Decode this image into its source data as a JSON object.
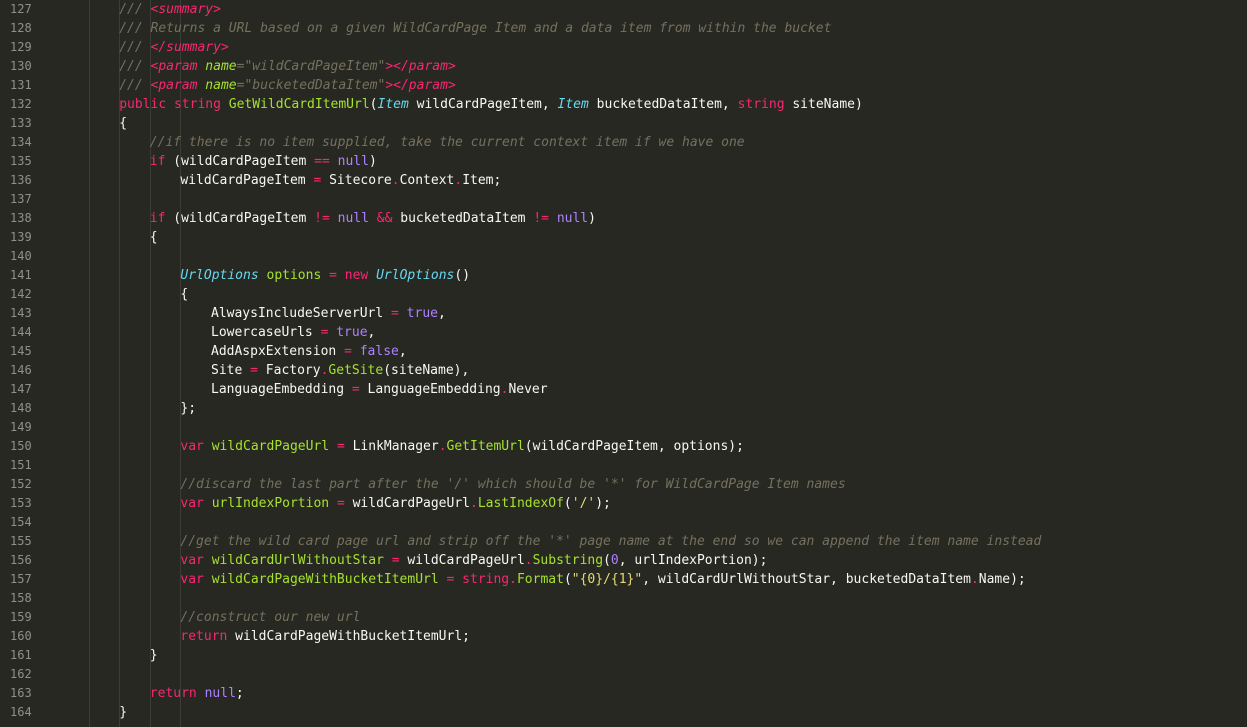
{
  "editor": {
    "theme_colors": {
      "background": "#272822",
      "line_number": "#8f908a",
      "comment": "#75715e",
      "keyword": "#f92672",
      "type": "#66d9ef",
      "function": "#a6e22e",
      "constant": "#ae81ff",
      "string": "#e6db74",
      "text": "#f8f8f2"
    },
    "lines": [
      {
        "n": "127",
        "indent": 2,
        "tokens": [
          [
            "comment",
            "/// "
          ],
          [
            "tag",
            "<summary>"
          ]
        ]
      },
      {
        "n": "128",
        "indent": 2,
        "tokens": [
          [
            "comment",
            "/// Returns a URL based on a given WildCardPage Item and a data item from within the bucket"
          ]
        ]
      },
      {
        "n": "129",
        "indent": 2,
        "tokens": [
          [
            "comment",
            "/// "
          ],
          [
            "tag",
            "</summary>"
          ]
        ]
      },
      {
        "n": "130",
        "indent": 2,
        "tokens": [
          [
            "comment",
            "/// "
          ],
          [
            "tag",
            "<param "
          ],
          [
            "attr",
            "name"
          ],
          [
            "comment",
            "="
          ],
          [
            "strit",
            "\"wildCardPageItem\""
          ],
          [
            "tag",
            "></param>"
          ]
        ]
      },
      {
        "n": "131",
        "indent": 2,
        "tokens": [
          [
            "comment",
            "/// "
          ],
          [
            "tag",
            "<param "
          ],
          [
            "attr",
            "name"
          ],
          [
            "comment",
            "="
          ],
          [
            "strit",
            "\"bucketedDataItem\""
          ],
          [
            "tag",
            "></param>"
          ]
        ]
      },
      {
        "n": "132",
        "indent": 2,
        "tokens": [
          [
            "kw",
            "public "
          ],
          [
            "kw",
            "string "
          ],
          [
            "fn",
            "GetWildCardItemUrl"
          ],
          [
            "plain",
            "("
          ],
          [
            "type",
            "Item"
          ],
          [
            "plain",
            " wildCardPageItem, "
          ],
          [
            "type",
            "Item"
          ],
          [
            "plain",
            " bucketedDataItem, "
          ],
          [
            "kw",
            "string"
          ],
          [
            "plain",
            " siteName)"
          ]
        ]
      },
      {
        "n": "133",
        "indent": 2,
        "tokens": [
          [
            "plain",
            "{"
          ]
        ]
      },
      {
        "n": "134",
        "indent": 3,
        "tokens": [
          [
            "comment",
            "//if there is no item supplied, take the current context item if we have one"
          ]
        ]
      },
      {
        "n": "135",
        "indent": 3,
        "tokens": [
          [
            "kw",
            "if"
          ],
          [
            "plain",
            " (wildCardPageItem "
          ],
          [
            "op",
            "=="
          ],
          [
            "plain",
            " "
          ],
          [
            "const",
            "null"
          ],
          [
            "plain",
            ")"
          ]
        ]
      },
      {
        "n": "136",
        "indent": 4,
        "tokens": [
          [
            "plain",
            "wildCardPageItem "
          ],
          [
            "op",
            "="
          ],
          [
            "plain",
            " Sitecore"
          ],
          [
            "op",
            "."
          ],
          [
            "plain",
            "Context"
          ],
          [
            "op",
            "."
          ],
          [
            "plain",
            "Item;"
          ]
        ]
      },
      {
        "n": "137",
        "indent": 0,
        "tokens": []
      },
      {
        "n": "138",
        "indent": 3,
        "tokens": [
          [
            "kw",
            "if"
          ],
          [
            "plain",
            " (wildCardPageItem "
          ],
          [
            "op",
            "!="
          ],
          [
            "plain",
            " "
          ],
          [
            "const",
            "null"
          ],
          [
            "plain",
            " "
          ],
          [
            "op",
            "&&"
          ],
          [
            "plain",
            " bucketedDataItem "
          ],
          [
            "op",
            "!="
          ],
          [
            "plain",
            " "
          ],
          [
            "const",
            "null"
          ],
          [
            "plain",
            ")"
          ]
        ]
      },
      {
        "n": "139",
        "indent": 3,
        "tokens": [
          [
            "plain",
            "{"
          ]
        ]
      },
      {
        "n": "140",
        "indent": 0,
        "tokens": []
      },
      {
        "n": "141",
        "indent": 4,
        "tokens": [
          [
            "type",
            "UrlOptions"
          ],
          [
            "plain",
            " "
          ],
          [
            "fn",
            "options"
          ],
          [
            "plain",
            " "
          ],
          [
            "op",
            "="
          ],
          [
            "plain",
            " "
          ],
          [
            "kw",
            "new"
          ],
          [
            "plain",
            " "
          ],
          [
            "type",
            "UrlOptions"
          ],
          [
            "plain",
            "()"
          ]
        ]
      },
      {
        "n": "142",
        "indent": 4,
        "tokens": [
          [
            "plain",
            "{"
          ]
        ]
      },
      {
        "n": "143",
        "indent": 5,
        "tokens": [
          [
            "plain",
            "AlwaysIncludeServerUrl "
          ],
          [
            "op",
            "="
          ],
          [
            "plain",
            " "
          ],
          [
            "const",
            "true"
          ],
          [
            "plain",
            ","
          ]
        ]
      },
      {
        "n": "144",
        "indent": 5,
        "tokens": [
          [
            "plain",
            "LowercaseUrls "
          ],
          [
            "op",
            "="
          ],
          [
            "plain",
            " "
          ],
          [
            "const",
            "true"
          ],
          [
            "plain",
            ","
          ]
        ]
      },
      {
        "n": "145",
        "indent": 5,
        "tokens": [
          [
            "plain",
            "AddAspxExtension "
          ],
          [
            "op",
            "="
          ],
          [
            "plain",
            " "
          ],
          [
            "const",
            "false"
          ],
          [
            "plain",
            ","
          ]
        ]
      },
      {
        "n": "146",
        "indent": 5,
        "tokens": [
          [
            "plain",
            "Site "
          ],
          [
            "op",
            "="
          ],
          [
            "plain",
            " Factory"
          ],
          [
            "op",
            "."
          ],
          [
            "fn",
            "GetSite"
          ],
          [
            "plain",
            "(siteName),"
          ]
        ]
      },
      {
        "n": "147",
        "indent": 5,
        "tokens": [
          [
            "plain",
            "LanguageEmbedding "
          ],
          [
            "op",
            "="
          ],
          [
            "plain",
            " LanguageEmbedding"
          ],
          [
            "op",
            "."
          ],
          [
            "plain",
            "Never"
          ]
        ]
      },
      {
        "n": "148",
        "indent": 4,
        "tokens": [
          [
            "plain",
            "};"
          ]
        ]
      },
      {
        "n": "149",
        "indent": 0,
        "tokens": []
      },
      {
        "n": "150",
        "indent": 4,
        "tokens": [
          [
            "kw",
            "var"
          ],
          [
            "plain",
            " "
          ],
          [
            "fn",
            "wildCardPageUrl"
          ],
          [
            "plain",
            " "
          ],
          [
            "op",
            "="
          ],
          [
            "plain",
            " LinkManager"
          ],
          [
            "op",
            "."
          ],
          [
            "fn",
            "GetItemUrl"
          ],
          [
            "plain",
            "(wildCardPageItem, options);"
          ]
        ]
      },
      {
        "n": "151",
        "indent": 0,
        "tokens": []
      },
      {
        "n": "152",
        "indent": 4,
        "tokens": [
          [
            "comment",
            "//discard the last part after the '/' which should be '*' for WildCardPage Item names"
          ]
        ]
      },
      {
        "n": "153",
        "indent": 4,
        "tokens": [
          [
            "kw",
            "var"
          ],
          [
            "plain",
            " "
          ],
          [
            "fn",
            "urlIndexPortion"
          ],
          [
            "plain",
            " "
          ],
          [
            "op",
            "="
          ],
          [
            "plain",
            " wildCardPageUrl"
          ],
          [
            "op",
            "."
          ],
          [
            "fn",
            "LastIndexOf"
          ],
          [
            "plain",
            "("
          ],
          [
            "str",
            "'/'"
          ],
          [
            "plain",
            ");"
          ]
        ]
      },
      {
        "n": "154",
        "indent": 0,
        "tokens": []
      },
      {
        "n": "155",
        "indent": 4,
        "tokens": [
          [
            "comment",
            "//get the wild card page url and strip off the '*' page name at the end so we can append the item name instead"
          ]
        ]
      },
      {
        "n": "156",
        "indent": 4,
        "tokens": [
          [
            "kw",
            "var"
          ],
          [
            "plain",
            " "
          ],
          [
            "fn",
            "wildCardUrlWithoutStar"
          ],
          [
            "plain",
            " "
          ],
          [
            "op",
            "="
          ],
          [
            "plain",
            " wildCardPageUrl"
          ],
          [
            "op",
            "."
          ],
          [
            "fn",
            "Substring"
          ],
          [
            "plain",
            "("
          ],
          [
            "const",
            "0"
          ],
          [
            "plain",
            ", urlIndexPortion);"
          ]
        ]
      },
      {
        "n": "157",
        "indent": 4,
        "tokens": [
          [
            "kw",
            "var"
          ],
          [
            "plain",
            " "
          ],
          [
            "fn",
            "wildCardPageWithBucketItemUrl"
          ],
          [
            "plain",
            " "
          ],
          [
            "op",
            "="
          ],
          [
            "plain",
            " "
          ],
          [
            "kw",
            "string"
          ],
          [
            "op",
            "."
          ],
          [
            "fn",
            "Format"
          ],
          [
            "plain",
            "("
          ],
          [
            "str",
            "\"{0}/{1}\""
          ],
          [
            "plain",
            ", wildCardUrlWithoutStar, bucketedDataItem"
          ],
          [
            "op",
            "."
          ],
          [
            "plain",
            "Name);"
          ]
        ]
      },
      {
        "n": "158",
        "indent": 0,
        "tokens": []
      },
      {
        "n": "159",
        "indent": 4,
        "tokens": [
          [
            "comment",
            "//construct our new url"
          ]
        ]
      },
      {
        "n": "160",
        "indent": 4,
        "tokens": [
          [
            "kw",
            "return"
          ],
          [
            "plain",
            " wildCardPageWithBucketItemUrl;"
          ]
        ]
      },
      {
        "n": "161",
        "indent": 3,
        "tokens": [
          [
            "plain",
            "}"
          ]
        ]
      },
      {
        "n": "162",
        "indent": 0,
        "tokens": []
      },
      {
        "n": "163",
        "indent": 3,
        "tokens": [
          [
            "kw",
            "return"
          ],
          [
            "plain",
            " "
          ],
          [
            "const",
            "null"
          ],
          [
            "plain",
            ";"
          ]
        ]
      },
      {
        "n": "164",
        "indent": 2,
        "tokens": [
          [
            "plain",
            "}"
          ]
        ]
      }
    ]
  }
}
